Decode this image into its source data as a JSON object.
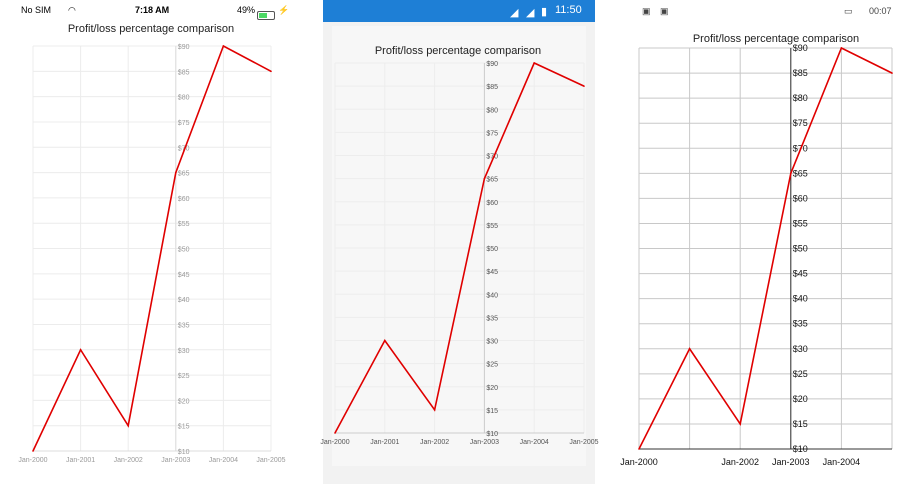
{
  "ios_status": {
    "carrier": "No SIM",
    "time": "7:18 AM",
    "battery": "49%"
  },
  "android_status": {
    "time": "11:50"
  },
  "windows_status": {
    "time": "00:07"
  },
  "colors": {
    "series": "#e00000",
    "android_bar": "#1e7fd6"
  },
  "chart_data": [
    {
      "type": "line",
      "title": "Profit/loss percentage comparison",
      "x": [
        "Jan-2000",
        "Jan-2001",
        "Jan-2002",
        "Jan-2003",
        "Jan-2004",
        "Jan-2005"
      ],
      "series": [
        {
          "values": [
            10,
            30,
            15,
            65,
            90,
            85
          ]
        }
      ],
      "ylim": [
        10,
        90
      ],
      "yticks": [
        "$10",
        "$15",
        "$20",
        "$25",
        "$30",
        "$35",
        "$40",
        "$45",
        "$50",
        "$55",
        "$60",
        "$65",
        "$70",
        "$75",
        "$80",
        "$85",
        "$90"
      ],
      "grid": true,
      "y_axis_position": "crosses at Jan-2003"
    },
    {
      "type": "line",
      "title": "Profit/loss percentage comparison",
      "x": [
        "Jan-2000",
        "Jan-2001",
        "Jan-2002",
        "Jan-2003",
        "Jan-2004",
        "Jan-2005"
      ],
      "series": [
        {
          "values": [
            10,
            30,
            15,
            65,
            90,
            85
          ]
        }
      ],
      "ylim": [
        10,
        90
      ],
      "yticks": [
        "$10",
        "$15",
        "$20",
        "$25",
        "$30",
        "$35",
        "$40",
        "$45",
        "$50",
        "$55",
        "$60",
        "$65",
        "$70",
        "$75",
        "$80",
        "$85",
        "$90"
      ],
      "grid": true,
      "y_axis_position": "crosses at Jan-2003"
    },
    {
      "type": "line",
      "title": "Profit/loss percentage comparison",
      "x": [
        "Jan-2000",
        "",
        "Jan-2002",
        "Jan-2003",
        "Jan-2004",
        ""
      ],
      "series": [
        {
          "values": [
            10,
            30,
            15,
            65,
            90,
            85
          ]
        }
      ],
      "ylim": [
        10,
        90
      ],
      "yticks": [
        "$10",
        "$15",
        "$20",
        "$25",
        "$30",
        "$35",
        "$40",
        "$45",
        "$50",
        "$55",
        "$60",
        "$65",
        "$70",
        "$75",
        "$80",
        "$85",
        "$90"
      ],
      "grid": true,
      "y_axis_position": "crosses at Jan-2003"
    }
  ]
}
